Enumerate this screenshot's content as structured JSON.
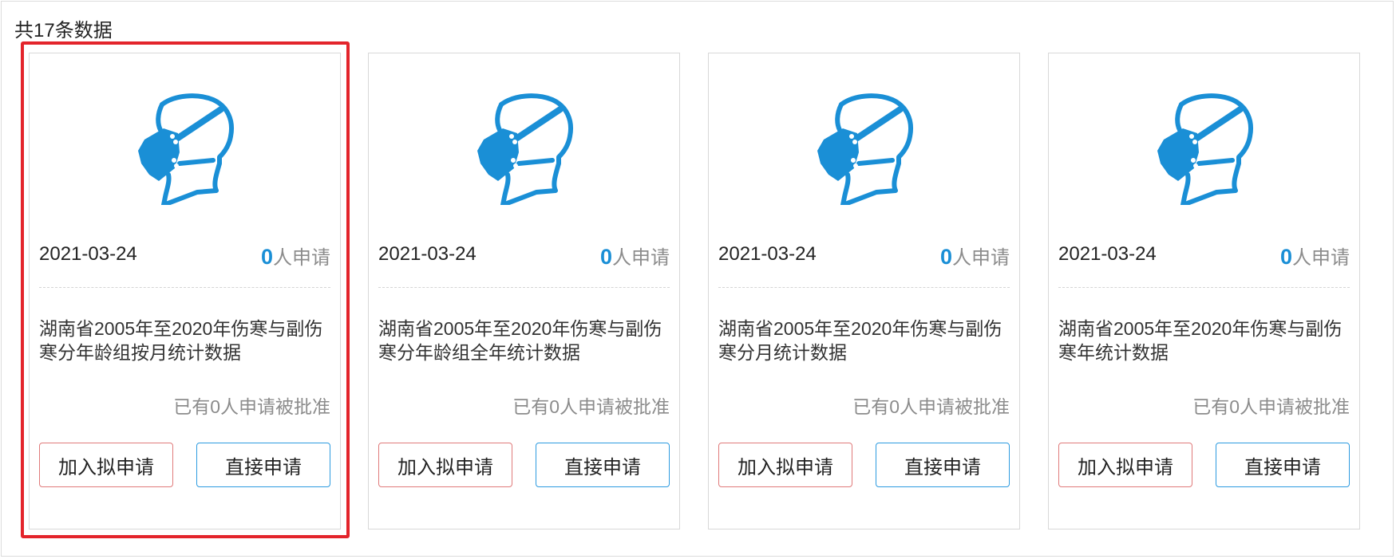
{
  "summary": {
    "total_text": "共17条数据"
  },
  "colors": {
    "accent_blue": "#1a8fd6",
    "highlight_red": "#e3242b",
    "draft_button_border": "#e07a7a",
    "direct_button_border": "#2d9be0"
  },
  "cards": [
    {
      "icon": "mask-head-icon",
      "date": "2021-03-24",
      "apply_count": "0",
      "apply_suffix": "人申请",
      "title": "湖南省2005年至2020年伤寒与副伤寒分年龄组按月统计数据",
      "approved_text": "已有0人申请被批准",
      "draft_button": "加入拟申请",
      "direct_button": "直接申请"
    },
    {
      "icon": "mask-head-icon",
      "date": "2021-03-24",
      "apply_count": "0",
      "apply_suffix": "人申请",
      "title": "湖南省2005年至2020年伤寒与副伤寒分年龄组全年统计数据",
      "approved_text": "已有0人申请被批准",
      "draft_button": "加入拟申请",
      "direct_button": "直接申请"
    },
    {
      "icon": "mask-head-icon",
      "date": "2021-03-24",
      "apply_count": "0",
      "apply_suffix": "人申请",
      "title": "湖南省2005年至2020年伤寒与副伤寒分月统计数据",
      "approved_text": "已有0人申请被批准",
      "draft_button": "加入拟申请",
      "direct_button": "直接申请"
    },
    {
      "icon": "mask-head-icon",
      "date": "2021-03-24",
      "apply_count": "0",
      "apply_suffix": "人申请",
      "title": "湖南省2005年至2020年伤寒与副伤寒年统计数据",
      "approved_text": "已有0人申请被批准",
      "draft_button": "加入拟申请",
      "direct_button": "直接申请"
    }
  ]
}
